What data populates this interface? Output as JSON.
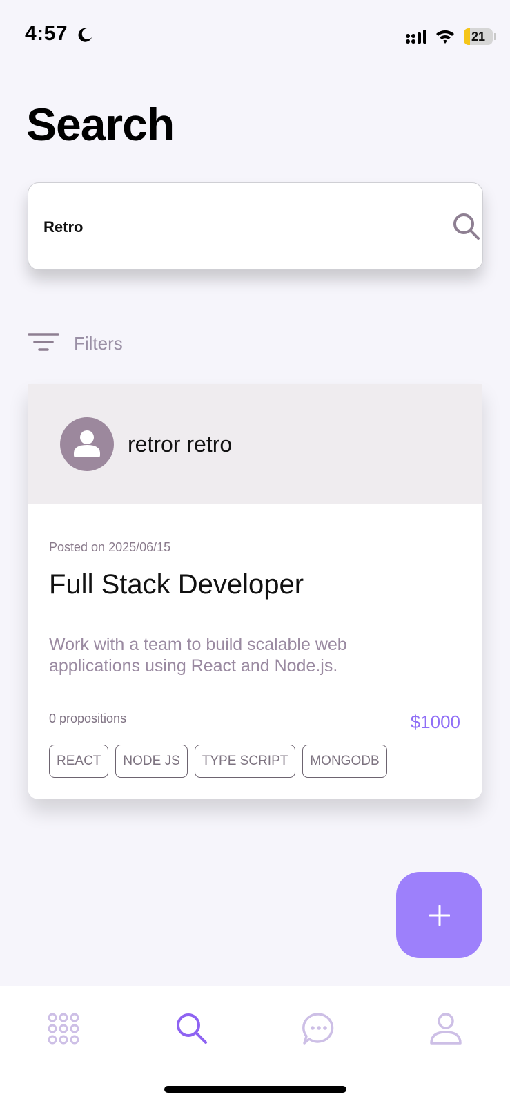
{
  "status_bar": {
    "time": "4:57",
    "battery": "21",
    "battery_level": 0.21
  },
  "page": {
    "title": "Search"
  },
  "search": {
    "value": "Retro",
    "placeholder": ""
  },
  "filters": {
    "label": "Filters"
  },
  "result_card": {
    "author_name": "retror retro",
    "posted": "Posted on 2025/06/15",
    "title": "Full Stack Developer",
    "description": "Work with a team to build scalable web applications using React and Node.js.",
    "propositions": "0 propositions",
    "price": "$1000",
    "tags": [
      "REACT",
      "NODE JS",
      "TYPE SCRIPT",
      "MONGODB"
    ]
  },
  "tab_bar": {
    "items": [
      {
        "icon": "grid-icon",
        "active": false
      },
      {
        "icon": "search-icon",
        "active": true
      },
      {
        "icon": "chat-icon",
        "active": false
      },
      {
        "icon": "profile-icon",
        "active": false
      }
    ]
  },
  "colors": {
    "accent": "#9d80fb",
    "price": "#8f6ef6",
    "muted_text": "#9a8aa1",
    "inactive_tab": "#cdbfe6",
    "avatar": "#9c889d"
  }
}
